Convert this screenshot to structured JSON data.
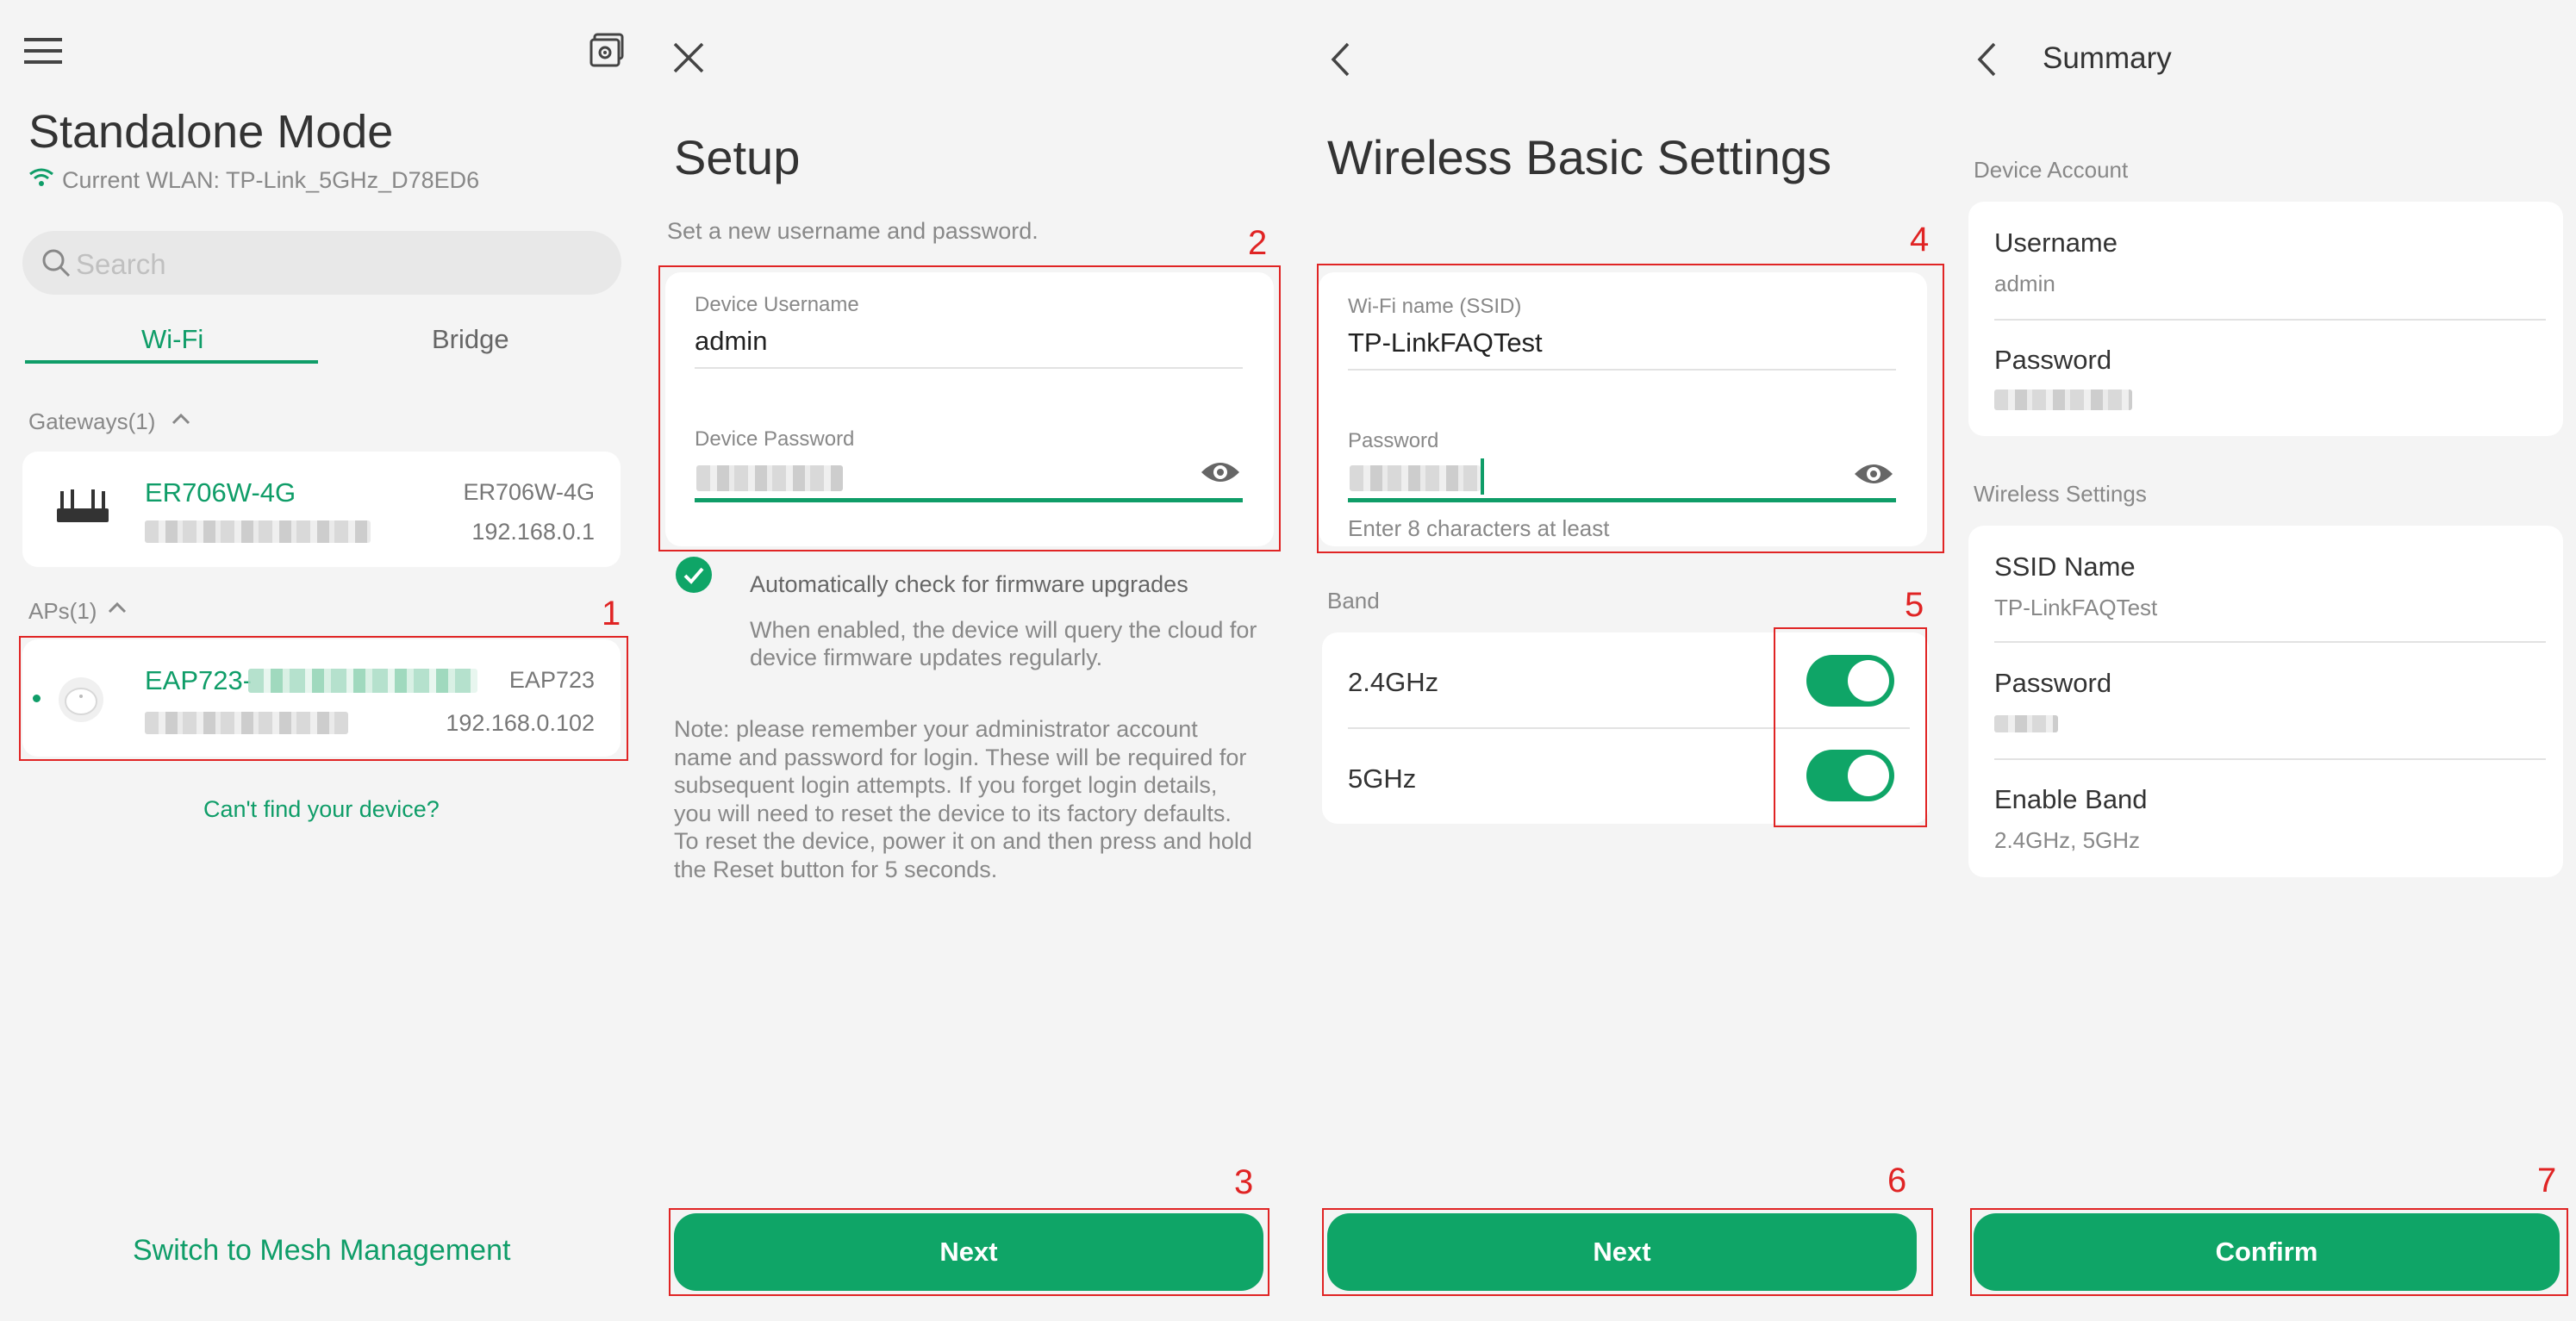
{
  "panel1": {
    "title": "Standalone Mode",
    "current_wlan": "Current WLAN: TP-Link_5GHz_D78ED6",
    "search_placeholder": "Search",
    "tabs": [
      "Wi-Fi",
      "Bridge"
    ],
    "gateways_header": "Gateways(1)",
    "gateway": {
      "name": "ER706W-4G",
      "model": "ER706W-4G",
      "ip": "192.168.0.1"
    },
    "aps_header": "APs(1)",
    "ap": {
      "name_prefix": "EAP723-",
      "model": "EAP723",
      "ip": "192.168.0.102"
    },
    "cant_find": "Can't find your device?",
    "switch_mesh": "Switch to Mesh Management",
    "step1": "1"
  },
  "panel2": {
    "title": "Setup",
    "subtitle": "Set a new username and password.",
    "username_label": "Device Username",
    "username_value": "admin",
    "password_label": "Device Password",
    "firmware_check": "Automatically check for firmware upgrades",
    "firmware_desc_1": "When enabled, the device will query the cloud for",
    "firmware_desc_2": "device firmware updates regularly.",
    "note_lines": [
      "Note: please remember your administrator account",
      "name and password for login. These will be required for",
      "subsequent login attempts. If you forget login details,",
      "you will need to reset the device to its factory defaults.",
      "To reset the device, power it on and then press and hold",
      "the Reset button for 5 seconds."
    ],
    "next": "Next",
    "step2": "2",
    "step3": "3"
  },
  "panel3": {
    "title": "Wireless Basic Settings",
    "ssid_label": "Wi-Fi name (SSID)",
    "ssid_value": "TP-LinkFAQTest",
    "password_label": "Password",
    "password_hint": "Enter 8 characters at least",
    "band_header": "Band",
    "bands": [
      {
        "label": "2.4GHz",
        "enabled": true
      },
      {
        "label": "5GHz",
        "enabled": true
      }
    ],
    "next": "Next",
    "step4": "4",
    "step5": "5",
    "step6": "6"
  },
  "panel4": {
    "title": "Summary",
    "device_account_header": "Device Account",
    "username_label": "Username",
    "username_value": "admin",
    "password_label": "Password",
    "wireless_header": "Wireless Settings",
    "ssid_name_label": "SSID Name",
    "ssid_name_value": "TP-LinkFAQTest",
    "wireless_password_label": "Password",
    "enable_band_label": "Enable Band",
    "enable_band_value": "2.4GHz, 5GHz",
    "confirm": "Confirm",
    "step7": "7"
  },
  "colors": {
    "accent": "#0fa567",
    "annotation": "#e02424",
    "background": "#f4f4f4"
  }
}
